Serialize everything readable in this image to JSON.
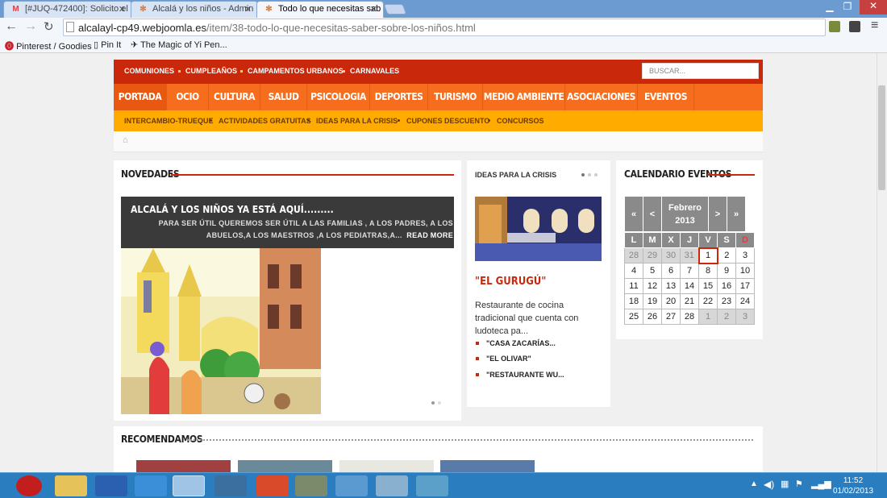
{
  "browser": {
    "tabs": [
      {
        "title": "[#JUQ-472400]: Solicito el",
        "icon": "gmail-icon"
      },
      {
        "title": "Alcalá y los niños - Admin",
        "icon": "joomla-icon"
      },
      {
        "title": "Todo lo que necesitas sab",
        "icon": "joomla-icon"
      }
    ],
    "url_host": "alcalayl-cp49.webjoomla.es",
    "url_path": "/item/38-todo-lo-que-necesitas-saber-sobre-los-niños.html",
    "bookmarks": [
      "Pinterest / Goodies",
      "Pin It",
      "The Magic of Yi Pen..."
    ]
  },
  "site": {
    "top_links": [
      "COMUNIONES",
      "CUMPLEAÑOS",
      "CAMPAMENTOS URBANOS",
      "CARNAVALES"
    ],
    "search_placeholder": "BUSCAR...",
    "nav": [
      "PORTADA",
      "OCIO",
      "CULTURA",
      "SALUD",
      "PSICOLOGIA",
      "DEPORTES",
      "TURISMO",
      "MEDIO AMBIENTE",
      "ASOCIACIONES",
      "EVENTOS"
    ],
    "sub_links": [
      "INTERCAMBIO-TRUEQUE",
      "ACTIVIDADES GRATUITAS",
      "IDEAS PARA LA CRISIS",
      "CUPONES DESCUENTO",
      "CONCURSOS"
    ]
  },
  "novedades": {
    "heading": "NOVEDADES",
    "featured_title": "ALCALÁ Y LOS NIÑOS YA ESTÁ AQUÍ.........",
    "featured_text": "PARA SER ÚTIL QUEREMOS SER ÚTIL A LAS FAMILIAS , A LOS PADRES, A LOS ABUELOS,A LOS MAESTROS ,A LOS PEDIATRAS,A...",
    "read_more": "READ MORE"
  },
  "ideas": {
    "heading": "IDEAS PARA LA CRISIS",
    "item_title": "\"EL GURUGÚ\"",
    "item_desc": "Restaurante de cocina tradicional que cuenta con ludoteca pa...",
    "links": [
      "\"CASA ZACARÍAS...",
      "\"EL OLIVAR\"",
      "\"RESTAURANTE WU..."
    ]
  },
  "calendar": {
    "heading": "CALENDARIO EVENTOS",
    "nav": [
      "«",
      "<",
      ">",
      "»"
    ],
    "month": "Febrero",
    "year": "2013",
    "weekdays": [
      "L",
      "M",
      "X",
      "J",
      "V",
      "S",
      "D"
    ],
    "weeks": [
      [
        "28",
        "29",
        "30",
        "31",
        "1",
        "2",
        "3"
      ],
      [
        "4",
        "5",
        "6",
        "7",
        "8",
        "9",
        "10"
      ],
      [
        "11",
        "12",
        "13",
        "14",
        "15",
        "16",
        "17"
      ],
      [
        "18",
        "19",
        "20",
        "21",
        "22",
        "23",
        "24"
      ],
      [
        "25",
        "26",
        "27",
        "28",
        "1",
        "2",
        "3"
      ]
    ]
  },
  "recomendados": {
    "heading": "RECOMENDAMOS"
  },
  "taskbar": {
    "time": "11:52",
    "date": "01/02/2013"
  }
}
